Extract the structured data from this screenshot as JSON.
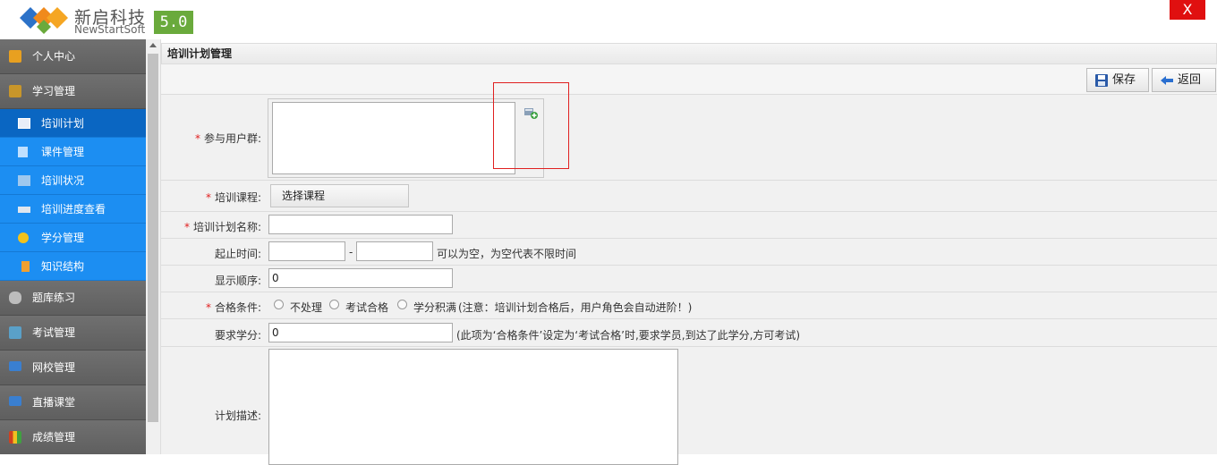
{
  "header": {
    "brand_cn": "新启科技",
    "brand_en": "NewStartSoft",
    "version": "5.0",
    "close_label": "X"
  },
  "sidebar": {
    "groups": [
      {
        "label": "个人中心",
        "icon": "person-center-icon",
        "color": "#e8a020"
      },
      {
        "label": "学习管理",
        "icon": "study-icon",
        "color": "#c8962a"
      },
      {
        "label": "题库练习",
        "icon": "question-bank-icon",
        "color": "#bdbdbd"
      },
      {
        "label": "考试管理",
        "icon": "exam-icon",
        "color": "#5aa0c8"
      },
      {
        "label": "网校管理",
        "icon": "school-monitor-icon",
        "color": "#3a7fd0"
      },
      {
        "label": "直播课堂",
        "icon": "live-class-icon",
        "color": "#3a7fd0"
      },
      {
        "label": "成绩管理",
        "icon": "score-chart-icon",
        "color": "#d04020"
      }
    ],
    "sub_items": [
      {
        "label": "培训计划",
        "icon": "plan-card-icon",
        "active": true
      },
      {
        "label": "课件管理",
        "icon": "document-icon"
      },
      {
        "label": "培训状况",
        "icon": "status-icon"
      },
      {
        "label": "培训进度查看",
        "icon": "progress-icon"
      },
      {
        "label": "学分管理",
        "icon": "credit-icon"
      },
      {
        "label": "知识结构",
        "icon": "knowledge-icon"
      }
    ]
  },
  "panel": {
    "title": "培训计划管理"
  },
  "toolbar": {
    "save_label": "保存",
    "back_label": "返回"
  },
  "form": {
    "user_group_label": "参与用户群:",
    "course_label": "培训课程:",
    "select_course_label": "选择课程",
    "plan_name_label": "培训计划名称:",
    "plan_name_value": "",
    "time_label": "起止时间:",
    "time_start": "",
    "time_end": "",
    "time_dash": "-",
    "time_hint": "可以为空，为空代表不限时间",
    "order_label": "显示顺序:",
    "order_value": "0",
    "pass_label": "合格条件:",
    "pass_options": [
      "不处理",
      "考试合格",
      "学分积满"
    ],
    "pass_hint": "(注意：培训计划合格后，用户角色会自动进阶！)",
    "credit_label": "要求学分:",
    "credit_value": "0",
    "credit_hint": "(此项为‘合格条件’设定为‘考试合格’时,要求学员,到达了此学分,方可考试)",
    "desc_label": "计划描述:"
  },
  "colors": {
    "accent": "#1c8ef2",
    "active": "#0a66c2",
    "close": "#e01010",
    "required": "#e02020",
    "version_bg": "#6aaa3c"
  }
}
